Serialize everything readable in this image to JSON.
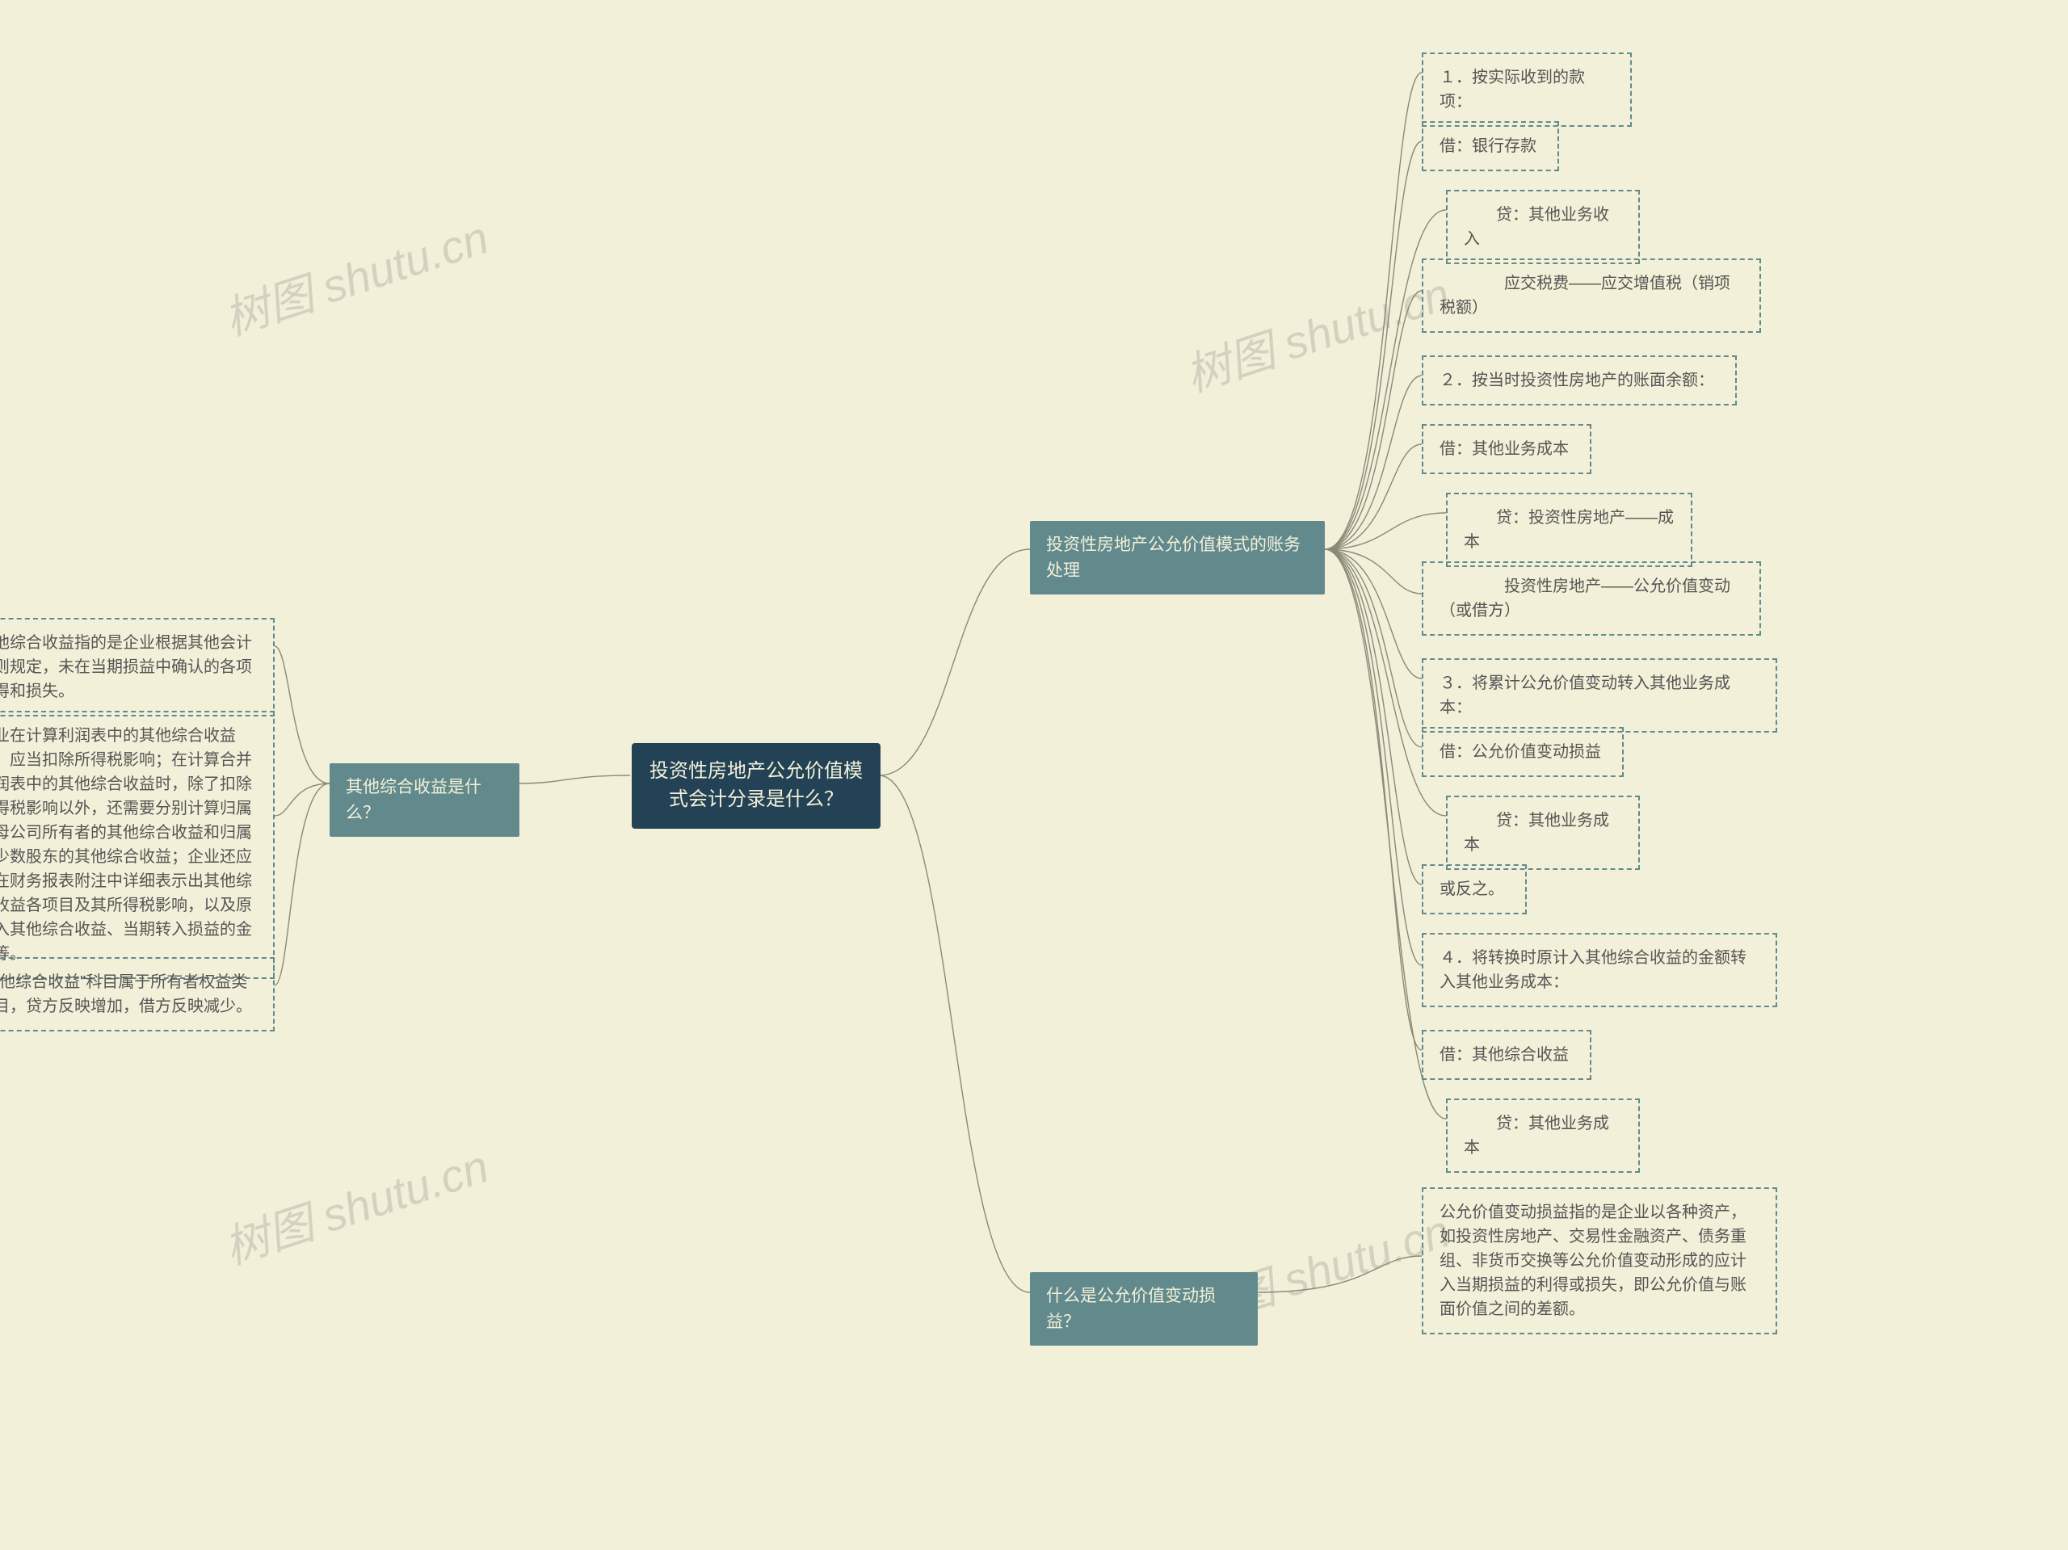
{
  "watermark": "树图 shutu.cn",
  "root": {
    "title": "投资性房地产公允价值模\n式会计分录是什么？"
  },
  "right": {
    "branch1": {
      "label": "投资性房地产公允价值模式的账务\n处理",
      "leaves": [
        "１．按实际收到的款项：",
        "借：银行存款",
        "　　贷：其他业务收入",
        "　　　　应交税费——应交增值税（销项税额）",
        "２．按当时投资性房地产的账面余额：",
        "借：其他业务成本",
        "　　贷：投资性房地产——成本",
        "　　　　投资性房地产——公允价值变动（或借方）",
        "３．将累计公允价值变动转入其他业务成本：",
        "借：公允价值变动损益",
        "　　贷：其他业务成本",
        "或反之。",
        "４．将转换时原计入其他综合收益的金额转入其他业务成本：",
        "借：其他综合收益",
        "　　贷：其他业务成本"
      ]
    },
    "branch2": {
      "label": "什么是公允价值变动损益？",
      "leaf": "公允价值变动损益指的是企业以各种资产，如投资性房地产、交易性金融资产、债务重组、非货币交换等公允价值变动形成的应计入当期损益的利得或损失，即公允价值与账面价值之间的差额。"
    }
  },
  "left": {
    "branch": {
      "label": "其他综合收益是什么？",
      "leaves": [
        "其他综合收益指的是企业根据其他会计准则规定，未在当期损益中确认的各项利得和损失。",
        "企业在计算利润表中的其他综合收益时，应当扣除所得税影响；在计算合并利润表中的其他综合收益时，除了扣除所得税影响以外，还需要分别计算归属于母公司所有者的其他综合收益和归属于少数股东的其他综合收益；企业还应当在财务报表附注中详细表示出其他综合收益各项目及其所得税影响，以及原计入其他综合收益、当期转入损益的金额等。",
        "\"其他综合收益\"科目属于所有者权益类科目，贷方反映增加，借方反映减少。"
      ]
    }
  }
}
